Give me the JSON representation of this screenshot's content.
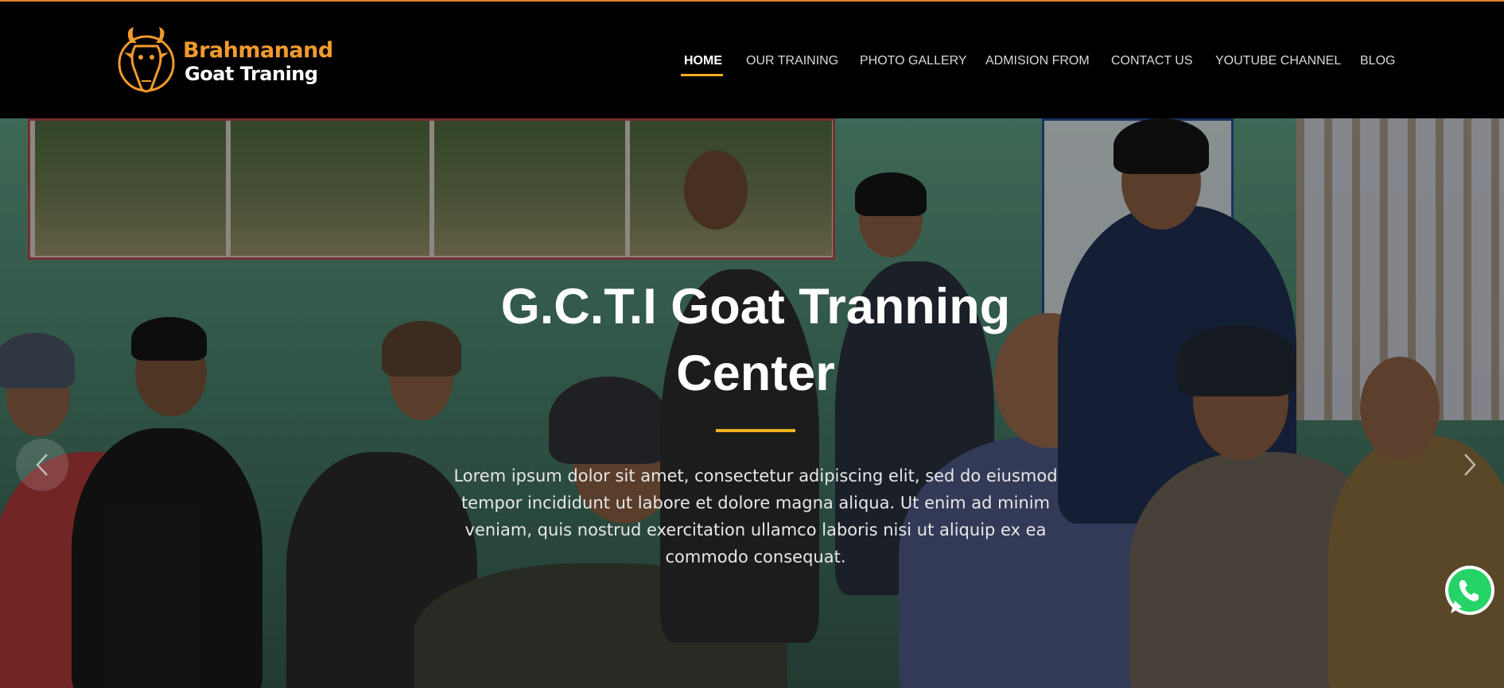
{
  "brand": {
    "line1": "Brahmanand",
    "line2": "Goat Traning",
    "logo_icon": "goat-head-icon",
    "accent_color": "#f29a2e"
  },
  "nav": {
    "items": [
      {
        "label": "HOME",
        "active": true
      },
      {
        "label": "OUR TRAINING",
        "active": false
      },
      {
        "label": "PHOTO GALLERY",
        "active": false
      },
      {
        "label": "ADMISION FROM",
        "active": false
      },
      {
        "label": "CONTACT US",
        "active": false
      },
      {
        "label": "YOUTUBE CHANNEL",
        "active": false
      },
      {
        "label": "BLOG",
        "active": false
      }
    ],
    "active_color": "#f0b020"
  },
  "hero": {
    "title": "G.C.T.I Goat Tranning Center",
    "description": "Lorem ipsum dolor sit amet, consectetur adipiscing elit, sed do eiusmod tempor incididunt ut labore et dolore magna aliqua. Ut enim ad minim veniam, quis nostrud exercitation ullamco laboris nisi ut aliquip ex ea commodo consequat.",
    "background_image": "classroom-photo",
    "prev_icon": "chevron-left-icon",
    "next_icon": "chevron-right-icon"
  },
  "whatsapp": {
    "icon": "whatsapp-icon",
    "color": "#25d366"
  }
}
